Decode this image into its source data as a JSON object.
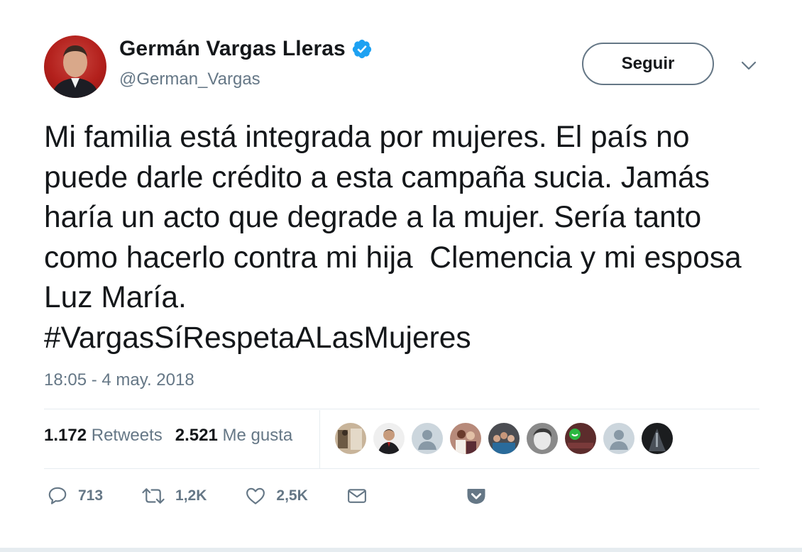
{
  "author": {
    "name": "Germán Vargas Lleras",
    "handle": "@German_Vargas",
    "verified": true
  },
  "follow_label": "Seguir",
  "tweet": {
    "text": "Mi familia está integrada por mujeres. El país no puede darle crédito a esta campaña sucia. Jamás haría un acto que degrade a la mujer. Sería tanto como hacerlo contra mi hija  Clemencia y mi esposa Luz María.",
    "hashtag": "#VargasSíRespetaALasMujeres",
    "timestamp": "18:05 - 4 may. 2018"
  },
  "stats": {
    "retweets_count": "1.172",
    "retweets_label": "Retweets",
    "likes_count": "2.521",
    "likes_label": "Me gusta"
  },
  "actions": {
    "reply_count": "713",
    "retweet_count": "1,2K",
    "like_count": "2,5K"
  },
  "colors": {
    "text": "#14171a",
    "secondary": "#657786",
    "verified_blue": "#1da1f2",
    "divider": "#e6ecf0"
  },
  "icons": [
    "verified-badge-icon",
    "chevron-down-icon",
    "reply-icon",
    "retweet-icon",
    "like-icon",
    "message-icon",
    "pocket-icon"
  ]
}
